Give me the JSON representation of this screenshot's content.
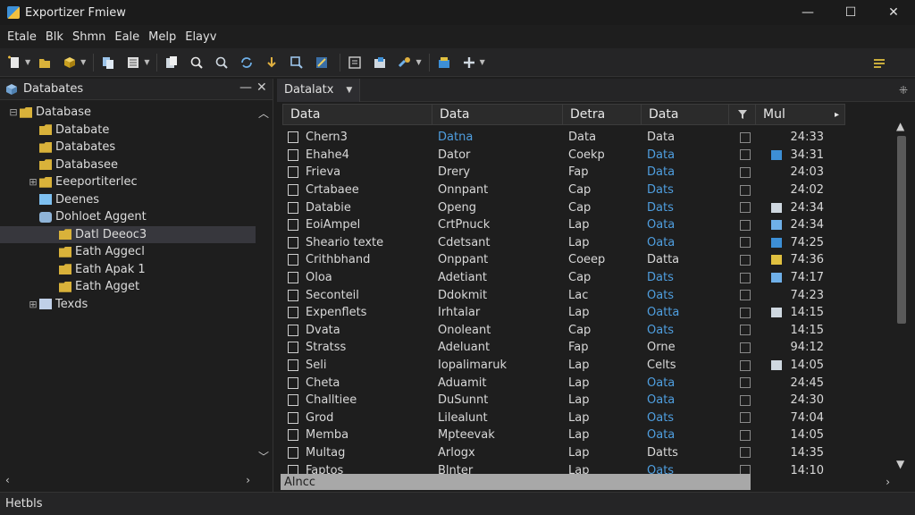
{
  "window": {
    "title": "Exportizer Fmiew",
    "minimize": "—",
    "maximize": "☐",
    "close": "✕"
  },
  "menu": [
    "Etale",
    "Blk",
    "Shmn",
    "Eale",
    "Melp",
    "Elayv"
  ],
  "toolbar": {
    "icons": [
      "new-file-icon",
      "open-icon",
      "database-icon",
      "copy-icon",
      "list-icon",
      "paste-icon",
      "search-icon",
      "find-icon",
      "refresh-icon",
      "download-icon",
      "find-replace-icon",
      "tools-icon",
      "calculator-icon",
      "export-icon",
      "connect-icon",
      "package-icon",
      "add-icon",
      "options-icon"
    ]
  },
  "left_panel": {
    "title": "Databates",
    "tree": [
      {
        "label": "Database",
        "level": 0,
        "expander": "⊟",
        "icon": "folder"
      },
      {
        "label": "Databate",
        "level": 1,
        "expander": "",
        "icon": "folder"
      },
      {
        "label": "Databates",
        "level": 1,
        "expander": "",
        "icon": "folder"
      },
      {
        "label": "Databasee",
        "level": 1,
        "expander": "",
        "icon": "folder"
      },
      {
        "label": "Eeeportiterlec",
        "level": 1,
        "expander": "⊞",
        "icon": "folder"
      },
      {
        "label": "Deenes",
        "level": 1,
        "expander": "",
        "icon": "file"
      },
      {
        "label": "Dohloet Aggent",
        "level": 1,
        "expander": "",
        "icon": "db"
      },
      {
        "label": "Datl Deeoc3",
        "level": 2,
        "expander": "",
        "icon": "folder",
        "selected": true
      },
      {
        "label": "Eath Aggecl",
        "level": 2,
        "expander": "",
        "icon": "folder"
      },
      {
        "label": "Eath Apak 1",
        "level": 2,
        "expander": "",
        "icon": "folder"
      },
      {
        "label": "Eath Agget",
        "level": 2,
        "expander": "",
        "icon": "folder"
      },
      {
        "label": "Texds",
        "level": 1,
        "expander": "⊞",
        "icon": "agent"
      }
    ]
  },
  "document_tab": {
    "label": "Datalatx"
  },
  "grid": {
    "headers": [
      "Data",
      "Data",
      "Detra",
      "Data",
      "",
      "Mul"
    ],
    "rows": [
      {
        "c0": "Chern3",
        "c1": "Datna",
        "c2": "Data",
        "c3": "Data",
        "c5": "24:33"
      },
      {
        "c0": "Ehahe4",
        "c1": "Dator",
        "c2": "Coekp",
        "c3": "Data",
        "c5": "34:31"
      },
      {
        "c0": "Frieva",
        "c1": "Drery",
        "c2": "Fap",
        "c3": "Data",
        "c5": "24:03"
      },
      {
        "c0": "Crtabaee",
        "c1": "Onnpant",
        "c2": "Cap",
        "c3": "Dats",
        "c5": "24:02"
      },
      {
        "c0": "Databie",
        "c1": "Openg",
        "c2": "Cap",
        "c3": "Dats",
        "c5": "24:34"
      },
      {
        "c0": "EoiAmpel",
        "c1": "CrtPnuck",
        "c2": "Lap",
        "c3": "Oata",
        "c5": "24:34"
      },
      {
        "c0": "Sheario texte",
        "c1": "Cdetsant",
        "c2": "Lap",
        "c3": "Oata",
        "c5": "74:25"
      },
      {
        "c0": "Crithbhand",
        "c1": "Onppant",
        "c2": "Coeep",
        "c3": "Datta",
        "c5": "74:36"
      },
      {
        "c0": "Oloa",
        "c1": "Adetiant",
        "c2": "Cap",
        "c3": "Dats",
        "c5": "74:17"
      },
      {
        "c0": "Seconteil",
        "c1": "Ddokmit",
        "c2": "Lac",
        "c3": "Oats",
        "c5": "74:23"
      },
      {
        "c0": "Expenflets",
        "c1": "Irhtalar",
        "c2": "Lap",
        "c3": "Oatta",
        "c5": "14:15"
      },
      {
        "c0": "Dvata",
        "c1": "Onoleant",
        "c2": "Cap",
        "c3": "Oats",
        "c5": "14:15"
      },
      {
        "c0": "Stratss",
        "c1": "Adeluant",
        "c2": "Fap",
        "c3": "Orne",
        "c5": "94:12"
      },
      {
        "c0": "Seli",
        "c1": "Iopalimaruk",
        "c2": "Lap",
        "c3": "Celts",
        "c5": "14:05"
      },
      {
        "c0": "Cheta",
        "c1": "Aduamit",
        "c2": "Lap",
        "c3": "Oata",
        "c5": "24:45"
      },
      {
        "c0": "Challtiee",
        "c1": "DuSunnt",
        "c2": "Lap",
        "c3": "Oata",
        "c5": "24:30"
      },
      {
        "c0": "Grod",
        "c1": "Lilealunt",
        "c2": "Lap",
        "c3": "Oats",
        "c5": "74:04"
      },
      {
        "c0": "Memba",
        "c1": "Mpteevak",
        "c2": "Lap",
        "c3": "Oata",
        "c5": "14:05"
      },
      {
        "c0": "Multag",
        "c1": "Arlogx",
        "c2": "Lap",
        "c3": "Datts",
        "c5": "14:35"
      },
      {
        "c0": "Faptos",
        "c1": "Blnter",
        "c2": "Lap",
        "c3": "Oats",
        "c5": "14:10"
      }
    ]
  },
  "grid_footer": "Alncc",
  "status": "Hetbls",
  "colors": {
    "accent": "#4f9fe0",
    "folder": "#d9b23a",
    "background": "#1e1e1e"
  }
}
